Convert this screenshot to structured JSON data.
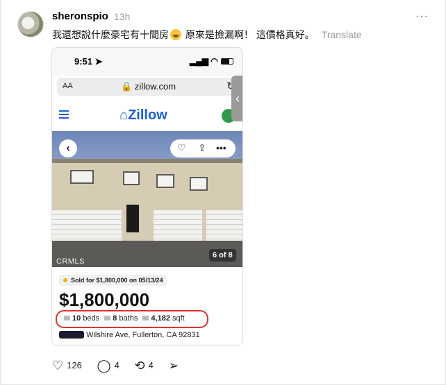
{
  "post": {
    "username": "sheronspio",
    "time": "13h",
    "more": "···",
    "text_part1": "我還想說什麼豪宅有十間房",
    "text_part2": " 原來是撿漏啊！ 這價格真好。",
    "emoji": "grinning-sweat-emoji",
    "translate": "Translate"
  },
  "screenshot": {
    "status_time": "9:51",
    "status_right": "▂▄▆ ◠",
    "url_aa": "AA",
    "url": "🔒 zillow.com",
    "zillow_logo": "Zillow",
    "photo_counter": "6 of 8",
    "crmls": "CRMLS",
    "sold_badge": "Sold for $1,800,000 on 05/13/24",
    "price": "$1,800,000",
    "beds": "10",
    "beds_label": "beds",
    "baths": "8",
    "baths_label": "baths",
    "sqft": "4,182",
    "sqft_label": "sqft",
    "address": "Wilshire Ave, Fullerton, CA 92831"
  },
  "actions": {
    "likes": "126",
    "comments": "4",
    "reposts": "4"
  },
  "colors": {
    "zillow_blue": "#1a5fd6",
    "highlight_red": "#e0312b"
  }
}
